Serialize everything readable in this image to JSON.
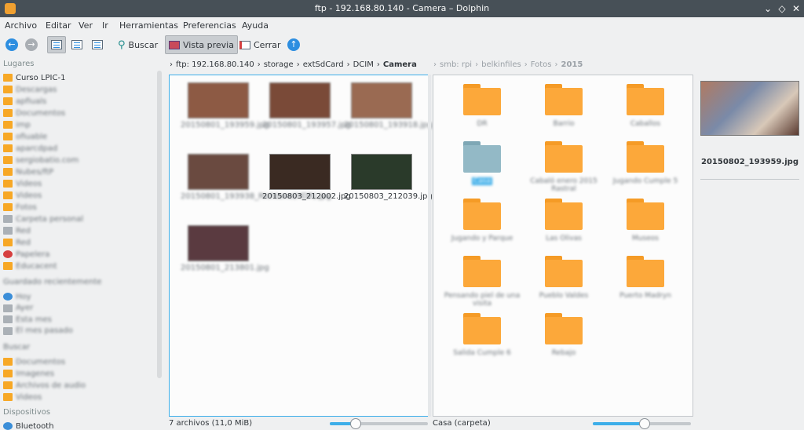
{
  "window": {
    "title": "ftp - 192.168.80.140 - Camera – Dolphin"
  },
  "menu": [
    "Archivo",
    "Editar",
    "Ver",
    "Ir",
    "Herramientas",
    "Preferencias",
    "Ayuda"
  ],
  "toolbar": {
    "search": "Buscar",
    "preview": "Vista previa",
    "close": "Cerrar"
  },
  "sidebar": {
    "places_header": "Lugares",
    "places": [
      "Curso LPIC-1",
      "Descargas",
      "apfiuals",
      "Documentos",
      "imp",
      "ofiuable",
      "aparcdpad",
      "sergiobatio.com",
      "Nubes/ftP",
      "Videos",
      "Videos",
      "Fotos",
      "Carpeta personal",
      "Red",
      "Red",
      "Papelera",
      "Educacent"
    ],
    "recent_header": "Guardado recientemente",
    "recent": [
      "Hoy",
      "Ayer",
      "Esta mes",
      "El mes pasado"
    ],
    "search_header": "Buscar",
    "search": [
      "Documentos",
      "Imagenes",
      "Archivos de audio",
      "Videos"
    ],
    "devices_header": "Dispositivos",
    "devices": [
      "Bluetooth"
    ]
  },
  "breadcrumb_left": {
    "root": "ftp: 192.168.80.140",
    "parts": [
      "storage",
      "extSdCard",
      "DCIM"
    ],
    "current": "Camera"
  },
  "breadcrumb_right": {
    "root": "smb: rpi",
    "parts": [
      "belkinfiles",
      "Fotos"
    ],
    "current": "2015"
  },
  "left_files": [
    {
      "name": "20150801_193959.jpg",
      "blurred": true,
      "color": "#8d5a44"
    },
    {
      "name": "20150801_193957.jpg",
      "blurred": true,
      "color": "#7a4a38"
    },
    {
      "name": "20150801_193918.jpg",
      "blurred": true,
      "color": "#9a6a52"
    },
    {
      "name": "20150801_193938_Richtone(HDR).jpg",
      "blurred": true,
      "color": "#6a4a40"
    },
    {
      "name": "20150803_212002.jpg",
      "blurred": false,
      "color": "#3a2a22"
    },
    {
      "name": "20150803_212039.jpg",
      "blurred": false,
      "color": "#2a3a2a"
    },
    {
      "name": "20150801_213801.jpg",
      "blurred": true,
      "color": "#5a3a40"
    }
  ],
  "right_folders": [
    {
      "name": "DR",
      "blue": false
    },
    {
      "name": "Barrio",
      "blue": false
    },
    {
      "name": "Caballos",
      "blue": false
    },
    {
      "name": "Casa",
      "blue": true
    },
    {
      "name": "Cabaló enero 2015 Rastral",
      "blue": false
    },
    {
      "name": "Jugando Cumple 5",
      "blue": false
    },
    {
      "name": "Jugando y Parque",
      "blue": false
    },
    {
      "name": "Las Olivas",
      "blue": false
    },
    {
      "name": "Museos",
      "blue": false
    },
    {
      "name": "Pensando piel de una visita",
      "blue": false
    },
    {
      "name": "Pueblo Valdes",
      "blue": false
    },
    {
      "name": "Puerto Madryn",
      "blue": false
    },
    {
      "name": "Salida Cumple 6",
      "blue": false
    },
    {
      "name": "Rebajo",
      "blue": false
    }
  ],
  "preview": {
    "filename": "20150802_193959.jpg"
  },
  "status": {
    "left": "7 archivos (11,0 MiB)",
    "right": "Casa (carpeta)",
    "zoom_left": 0.12,
    "zoom_right": 0.24
  },
  "colors": {
    "accent": "#3daee9",
    "folder": "#fca83a",
    "titlebar": "#475057"
  }
}
